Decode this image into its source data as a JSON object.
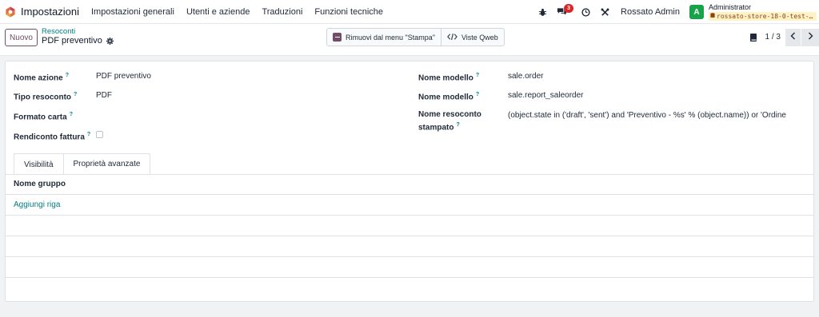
{
  "navbar": {
    "app_name": "Impostazioni",
    "menu": [
      "Impostazioni generali",
      "Utenti e aziende",
      "Traduzioni",
      "Funzioni tecniche"
    ],
    "messages_badge": "3",
    "company": "Rossato Admin",
    "user_initial": "A",
    "user_name": "Administrator",
    "database": "rossato-store-18-0-test-…"
  },
  "control_panel": {
    "new_label": "Nuovo",
    "breadcrumb_parent": "Resoconti",
    "breadcrumb_current": "PDF preventivo",
    "remove_from_print_label": "Rimuovi dal menu \"Stampa\"",
    "qweb_views_label": "Viste Qweb",
    "pager_value": "1 / 3"
  },
  "form": {
    "left": [
      {
        "label": "Nome azione",
        "value": "PDF preventivo"
      },
      {
        "label": "Tipo resoconto",
        "value": "PDF"
      },
      {
        "label": "Formato carta",
        "value": ""
      },
      {
        "label": "Rendiconto fattura",
        "value": ""
      }
    ],
    "right": [
      {
        "label": "Nome modello",
        "value": "sale.order"
      },
      {
        "label": "Nome modello",
        "value": "sale.report_saleorder"
      },
      {
        "label_line1": "Nome resoconto",
        "label_line2": "stampato",
        "value": "(object.state in ('draft', 'sent') and 'Preventivo - %s' % (object.name)) or 'Ordine"
      }
    ],
    "help_marker": "?"
  },
  "notebook": {
    "tabs": [
      "Visibilità",
      "Proprietà avanzate"
    ],
    "active_tab": "Visibilità",
    "column_header": "Nome gruppo",
    "add_line": "Aggiungi riga"
  },
  "colors": {
    "brand": "#714b67",
    "link": "#017e84",
    "badge": "#dc2626",
    "avatar": "#16a34a"
  }
}
